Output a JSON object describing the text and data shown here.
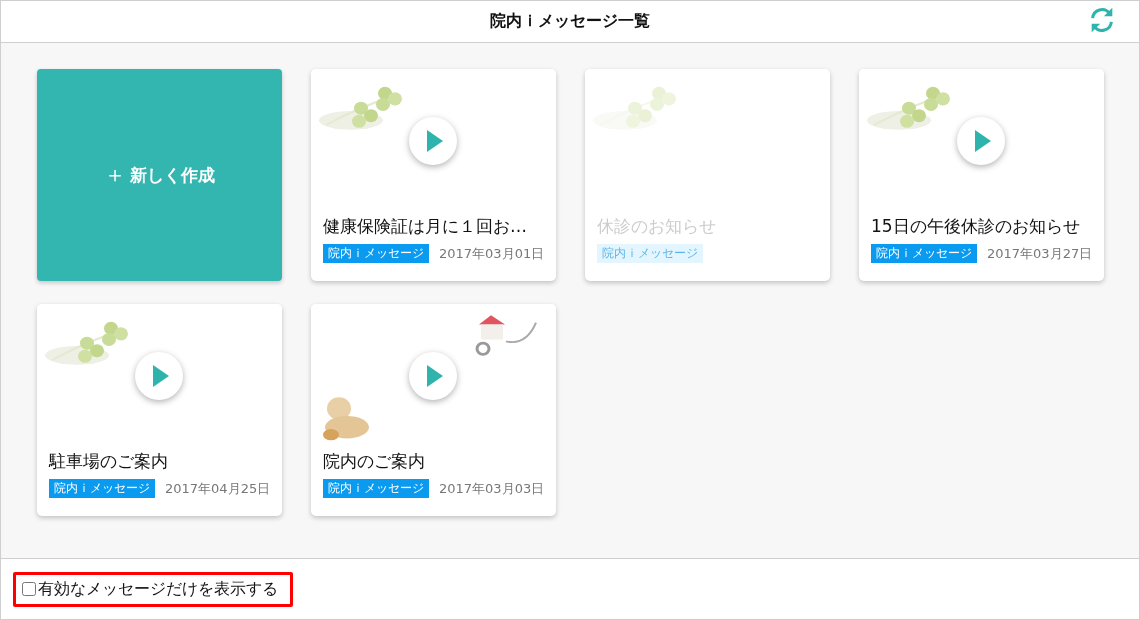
{
  "header": {
    "title": "院内ｉメッセージ一覧"
  },
  "new_button": {
    "icon": "＋",
    "label": "新しく作成"
  },
  "cards": [
    {
      "title": "健康保険証は月に１回お…",
      "tag": "院内ｉメッセージ",
      "date": "2017年03月01日",
      "disabled": false,
      "kind": "clover"
    },
    {
      "title": "休診のお知らせ",
      "tag": "院内ｉメッセージ",
      "disabled": true,
      "kind": "clover"
    },
    {
      "title": "15日の午後休診のお知らせ",
      "tag": "院内ｉメッセージ",
      "date": "2017年03月27日",
      "disabled": false,
      "kind": "clover"
    },
    {
      "title": "駐車場のご案内",
      "tag": "院内ｉメッセージ",
      "date": "2017年04月25日",
      "disabled": false,
      "kind": "clover"
    },
    {
      "title": "院内のご案内",
      "tag": "院内ｉメッセージ",
      "date": "2017年03月03日",
      "disabled": false,
      "kind": "clinic"
    }
  ],
  "filter": {
    "label": "有効なメッセージだけを表示する",
    "checked": false
  }
}
